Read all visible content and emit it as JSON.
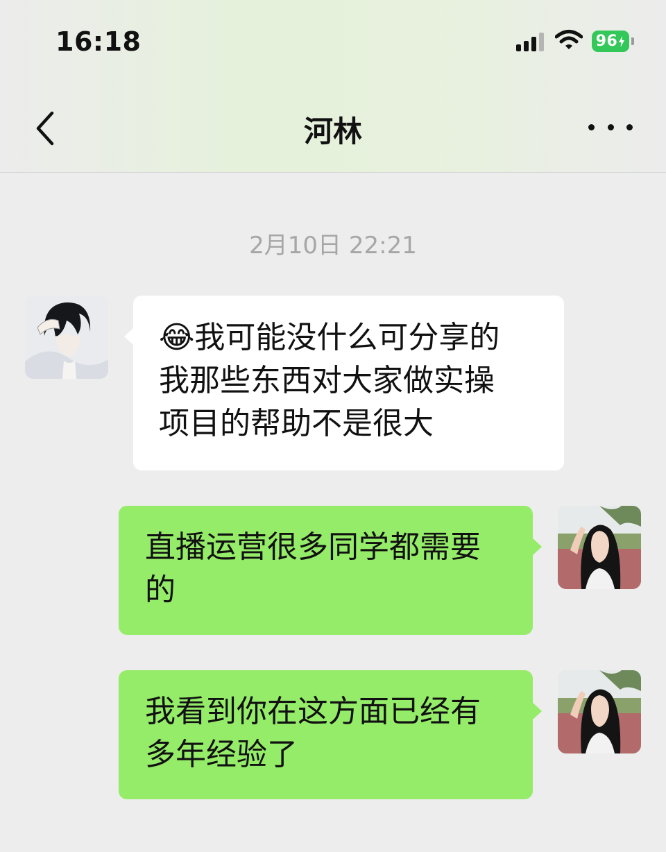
{
  "status_bar": {
    "time": "16:18",
    "battery": "96",
    "icons": [
      "signal-icon",
      "wifi-icon",
      "battery-icon"
    ]
  },
  "header": {
    "title": "河林",
    "back_icon": "chevron-left-icon",
    "more_icon": "ellipsis-icon"
  },
  "chat": {
    "timestamp": "2月10日 22:21",
    "messages": [
      {
        "side": "incoming",
        "emoji": "😂",
        "text": "我可能没什么可分享的\n我那些东西对大家做实操\n项目的帮助不是很大"
      },
      {
        "side": "outgoing",
        "text": "直播运营很多同学都需要\n的"
      },
      {
        "side": "outgoing",
        "text": "我看到你在这方面已经有\n多年经验了"
      }
    ]
  },
  "colors": {
    "background": "#ededed",
    "bubble_incoming": "#ffffff",
    "bubble_outgoing": "#95ec69",
    "battery": "#34c759",
    "timestamp_text": "#a6a6a6"
  }
}
